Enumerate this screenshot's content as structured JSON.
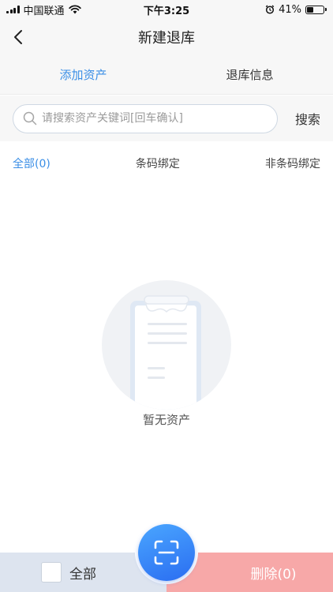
{
  "status_bar": {
    "carrier": "中国联通",
    "time": "下午3:25",
    "battery_percent": "41%",
    "battery_level": 0.41,
    "icons": [
      "signal-icon",
      "wifi-icon",
      "alarm-icon",
      "battery-icon"
    ]
  },
  "nav": {
    "title": "新建退库",
    "back_icon": "chevron-left-icon"
  },
  "tabs": [
    {
      "label": "添加资产",
      "active": true
    },
    {
      "label": "退库信息",
      "active": false
    }
  ],
  "search": {
    "placeholder": "请搜索资产关键词[回车确认]",
    "value": "",
    "button_label": "搜索",
    "icon": "search-icon"
  },
  "filters": [
    {
      "label": "全部(0)",
      "active": true
    },
    {
      "label": "条码绑定",
      "active": false
    },
    {
      "label": "非条码绑定",
      "active": false
    }
  ],
  "empty_state": {
    "text": "暂无资产",
    "icon": "clipboard-empty-icon"
  },
  "bottom": {
    "select_all_label": "全部",
    "select_all_checked": false,
    "delete_label": "删除(0)",
    "scan_icon": "scan-icon"
  },
  "colors": {
    "accent": "#3a8ee6",
    "delete_bg": "#f7a8a8",
    "select_all_bg": "#dde4ef",
    "scan_gradient_start": "#4aa6ff",
    "scan_gradient_end": "#2a6df1"
  }
}
